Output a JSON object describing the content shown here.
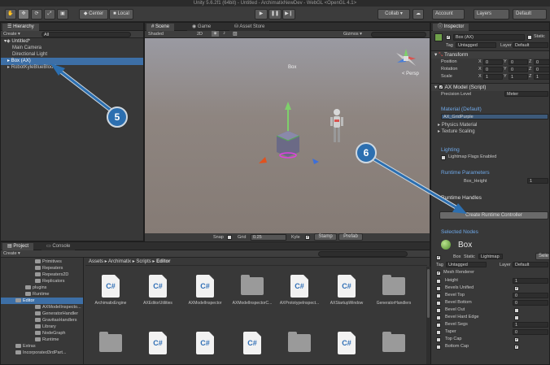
{
  "window": {
    "title": "Unity 5.6.2f1 (64bit) - Untitled - ArchimatixNewDev - WebGL <OpenGL 4.1>"
  },
  "toolbar": {
    "center": "Center",
    "local": "Local",
    "collab": "Collab ▾",
    "account": "Account",
    "layers": "Layers",
    "layout": "Default"
  },
  "hierarchy": {
    "tab": "Hierarchy",
    "create": "Create ▾",
    "search_placeholder": "All",
    "scene": "Untitled*",
    "items": [
      "Main Camera",
      "Directional Light",
      "Box (AX)",
      "RobotKyleBlueBlood"
    ]
  },
  "scene_view": {
    "tabs": [
      "Scene",
      "Game",
      "Asset Store"
    ],
    "shading": "Shaded",
    "mode2d": "2D",
    "gizmos": "Gizmos ▾",
    "persp": "< Persp",
    "object_label": "Box",
    "snap_label": "Snap",
    "grid_label": "Grid",
    "grid_value": "0.25",
    "kyle_label": "Kyle",
    "stamp": "Stamp",
    "prefab": "Prefab"
  },
  "project": {
    "tabs": [
      "Project",
      "Console"
    ],
    "create": "Create ▾",
    "breadcrumb": [
      "Assets",
      "Archimatix",
      "Scripts",
      "Editor"
    ],
    "tree": [
      {
        "label": "Primitives",
        "indent": 3
      },
      {
        "label": "Repeaters",
        "indent": 3
      },
      {
        "label": "Repeaters2D",
        "indent": 3
      },
      {
        "label": "Replicators",
        "indent": 3
      },
      {
        "label": "plugins",
        "indent": 2
      },
      {
        "label": "Runtime",
        "indent": 2
      },
      {
        "label": "Editor",
        "indent": 1
      },
      {
        "label": "AXModelInspecto...",
        "indent": 3
      },
      {
        "label": "GeneratorHandler",
        "indent": 3
      },
      {
        "label": "GravitasHandlers",
        "indent": 3
      },
      {
        "label": "Library",
        "indent": 3
      },
      {
        "label": "NodeGraph",
        "indent": 3
      },
      {
        "label": "Runtime",
        "indent": 3
      },
      {
        "label": "Extras",
        "indent": 1
      },
      {
        "label": "Incorporated3rdPart...",
        "indent": 1
      }
    ],
    "files": [
      {
        "name": "ArchimatixEngine",
        "kind": "cs"
      },
      {
        "name": "AXEditorUtilities",
        "kind": "cs"
      },
      {
        "name": "AXModelInspector",
        "kind": "cs"
      },
      {
        "name": "AXModelInspectorC...",
        "kind": "folder"
      },
      {
        "name": "AXPrototypeInspect...",
        "kind": "cs"
      },
      {
        "name": "AXStartupWindow",
        "kind": "cs"
      },
      {
        "name": "GeneratorHandlers",
        "kind": "folder"
      }
    ]
  },
  "inspector": {
    "tab": "Inspector",
    "object_name": "Box (AX)",
    "static": "Static",
    "tag_label": "Tag",
    "tag_value": "Untagged",
    "layer_label": "Layer",
    "layer_value": "Default",
    "transform": {
      "title": "Transform",
      "rows": [
        {
          "label": "Position",
          "x": "0",
          "y": "0",
          "z": "0"
        },
        {
          "label": "Rotation",
          "x": "0",
          "y": "0",
          "z": "0"
        },
        {
          "label": "Scale",
          "x": "1",
          "y": "1",
          "z": "1"
        }
      ]
    },
    "ax_model": "AX Model (Script)",
    "precision_label": "Precision Level",
    "precision_value": "Meter",
    "material_title": "Material (Default)",
    "material_value": "AX_GridPurple",
    "physics_material": "Physics Material",
    "texture_scaling": "Texture Scaling",
    "lighting_title": "Lighting",
    "lightmap_flags": "Lightmap Flags Enabled",
    "runtime_params_title": "Runtime Parameters",
    "box_height_label": "Box_Height",
    "box_height_value": "1",
    "runtime_handles_title": "Runtime Handles",
    "create_runtime_button": "Create Runtime Controller",
    "selected_nodes_title": "Selected Nodes",
    "selected_node_name": "Box",
    "node_name_field": "Box",
    "node_static": "Static",
    "node_lightmap": "Lightmap",
    "node_select": "Sele",
    "node_tag_label": "Tag",
    "node_tag_value": "Untagged",
    "node_layer_label": "Layer",
    "node_layer_value": "Default",
    "mesh_renderer": "Mesh Renderer",
    "params": [
      {
        "label": "Height",
        "value": "1",
        "kind": "num"
      },
      {
        "label": "Bevels Unified",
        "value": "",
        "kind": "chk",
        "checked": true
      },
      {
        "label": "Bevel Top",
        "value": "0",
        "kind": "num"
      },
      {
        "label": "Bevel Bottom",
        "value": "0",
        "kind": "num"
      },
      {
        "label": "Bevel Out",
        "value": "",
        "kind": "chk",
        "checked": false
      },
      {
        "label": "Bevel Hard Edge",
        "value": "",
        "kind": "chk",
        "checked": false
      },
      {
        "label": "Bevel Segs",
        "value": "1",
        "kind": "num"
      },
      {
        "label": "Taper",
        "value": "0",
        "kind": "num"
      },
      {
        "label": "Top Cap",
        "value": "",
        "kind": "chk",
        "checked": true
      },
      {
        "label": "Bottom Cap",
        "value": "",
        "kind": "chk",
        "checked": true
      }
    ]
  },
  "annotations": {
    "badge5": "5",
    "badge6": "6"
  },
  "colors": {
    "accent_blue": "#2c6fb0",
    "selection": "#3d6fa6",
    "scene_bg": "#8b817b"
  }
}
